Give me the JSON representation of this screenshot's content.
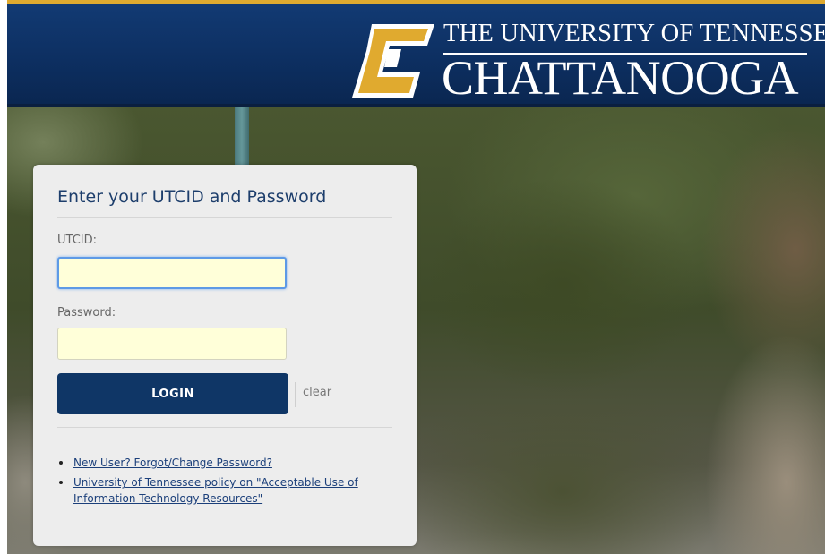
{
  "header": {
    "brand_top": "THE UNIVERSITY OF TENNESSEE",
    "brand_main": "CHATTANOOGA",
    "logo_icon": "utc-c-logo-icon",
    "colors": {
      "navy": "#0d2f61",
      "gold": "#e0aa2f"
    }
  },
  "login": {
    "title": "Enter your UTCID and Password",
    "utcid_label": "UTCID:",
    "utcid_value": "",
    "password_label": "Password:",
    "password_value": "",
    "login_button": "LOGIN",
    "clear_link": "clear"
  },
  "links": [
    "New User? Forgot/Change Password?",
    "University of Tennessee policy on \"Acceptable Use of Information Technology Resources\""
  ]
}
